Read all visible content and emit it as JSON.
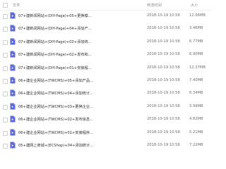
{
  "header": {
    "name_label": "文件",
    "time_label": "修改时间",
    "size_label": "大小"
  },
  "colors": {
    "icon_fill": "#5e6bd6",
    "divider": "#eeeeee"
  },
  "files": [
    {
      "name": "07+建新闻网站+(DIY-Page)+05+更换模...",
      "time": "2018-10-19 10:58",
      "size": "12.06MB"
    },
    {
      "name": "07+建新闻网站+(DIY-Page)+04+添加产...",
      "time": "2018-10-19 10:58",
      "size": "3.46MB"
    },
    {
      "name": "07+建新闻网站+(DIY-Page)+03+添加统...",
      "time": "2018-10-19 10:58",
      "size": "6.77MB"
    },
    {
      "name": "07+建新闻网站+(DIY-Page)+02+发布和...",
      "time": "2018-10-19 10:58",
      "size": "6.90MB"
    },
    {
      "name": "07+建新闻网站+(DIY-Page)+01+安装程...",
      "time": "2018-10-19 10:58",
      "size": "12.37MB"
    },
    {
      "name": "06+建企业网站+(TWCMS)+05+添加产品...",
      "time": "2018-10-19 10:58",
      "size": "7.40MB"
    },
    {
      "name": "06+建企业网站+(TWCMS)+04+添加统计...",
      "time": "2018-10-19 10:58",
      "size": "6.34MB"
    },
    {
      "name": "06+建企业网站+(TWCMS)+03+更换企业...",
      "time": "2018-10-19 10:58",
      "size": "3.99MB"
    },
    {
      "name": "06+建企业网站+(TWCMS)+02+发布信息...",
      "time": "2018-10-19 10:58",
      "size": "4.82MB"
    },
    {
      "name": "06+建企业网站+(TWCMS)+01+安装程序...",
      "time": "2018-10-19 10:58",
      "size": "5.21MB"
    },
    {
      "name": "05+建网上商城+(ECShop)+04+添加统计...",
      "time": "2018-10-19 10:58",
      "size": "7.22MB"
    }
  ]
}
